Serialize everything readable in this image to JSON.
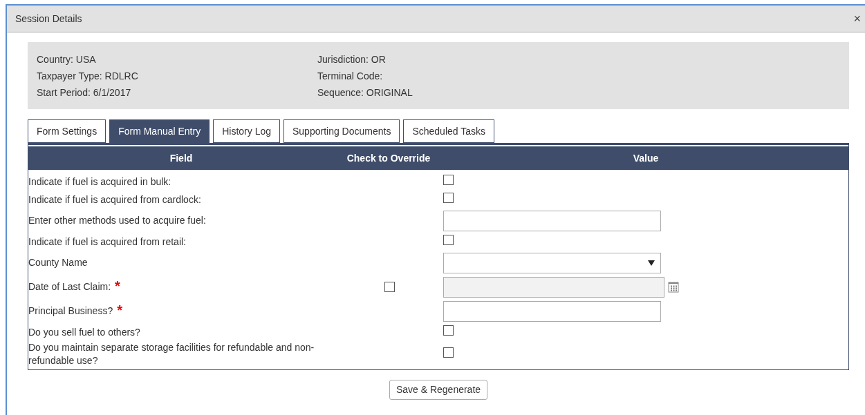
{
  "window": {
    "title": "Session Details",
    "close": "×"
  },
  "info": {
    "left": [
      "Country: USA",
      "Taxpayer Type: RDLRC",
      "Start Period: 6/1/2017"
    ],
    "right": [
      "Jurisdiction: OR",
      "Terminal Code:",
      "Sequence: ORIGINAL"
    ]
  },
  "tabs": [
    {
      "label": "Form Settings",
      "selected": false
    },
    {
      "label": "Form Manual Entry",
      "selected": true
    },
    {
      "label": "History Log",
      "selected": false
    },
    {
      "label": "Supporting Documents",
      "selected": false
    },
    {
      "label": "Scheduled Tasks",
      "selected": false
    }
  ],
  "table": {
    "columns": [
      "Field",
      "Check to Override",
      "Value"
    ],
    "rows": [
      {
        "label": "Indicate if fuel is acquired in bulk:",
        "kind": "checkbox",
        "checked": false
      },
      {
        "label": "Indicate if fuel is acquired from cardlock:",
        "kind": "checkbox",
        "checked": false
      },
      {
        "label": "Enter other methods used to acquire fuel:",
        "kind": "text"
      },
      {
        "label": "Indicate if fuel is acquired from retail:",
        "kind": "checkbox",
        "checked": false
      },
      {
        "label": "County Name",
        "kind": "select"
      },
      {
        "label": "Date of Last Claim:",
        "kind": "date",
        "required_mark": "*",
        "disabled": true,
        "override": {
          "checked": false
        }
      },
      {
        "label": "Principal Business?",
        "kind": "text",
        "required_mark": "*"
      },
      {
        "label": "Do you sell fuel to others?",
        "kind": "checkbox",
        "checked": false
      },
      {
        "label": "Do you maintain separate storage facilities for refundable and non-refundable use?",
        "kind": "checkbox",
        "checked": false
      }
    ]
  },
  "button": "Save & Regenerate"
}
